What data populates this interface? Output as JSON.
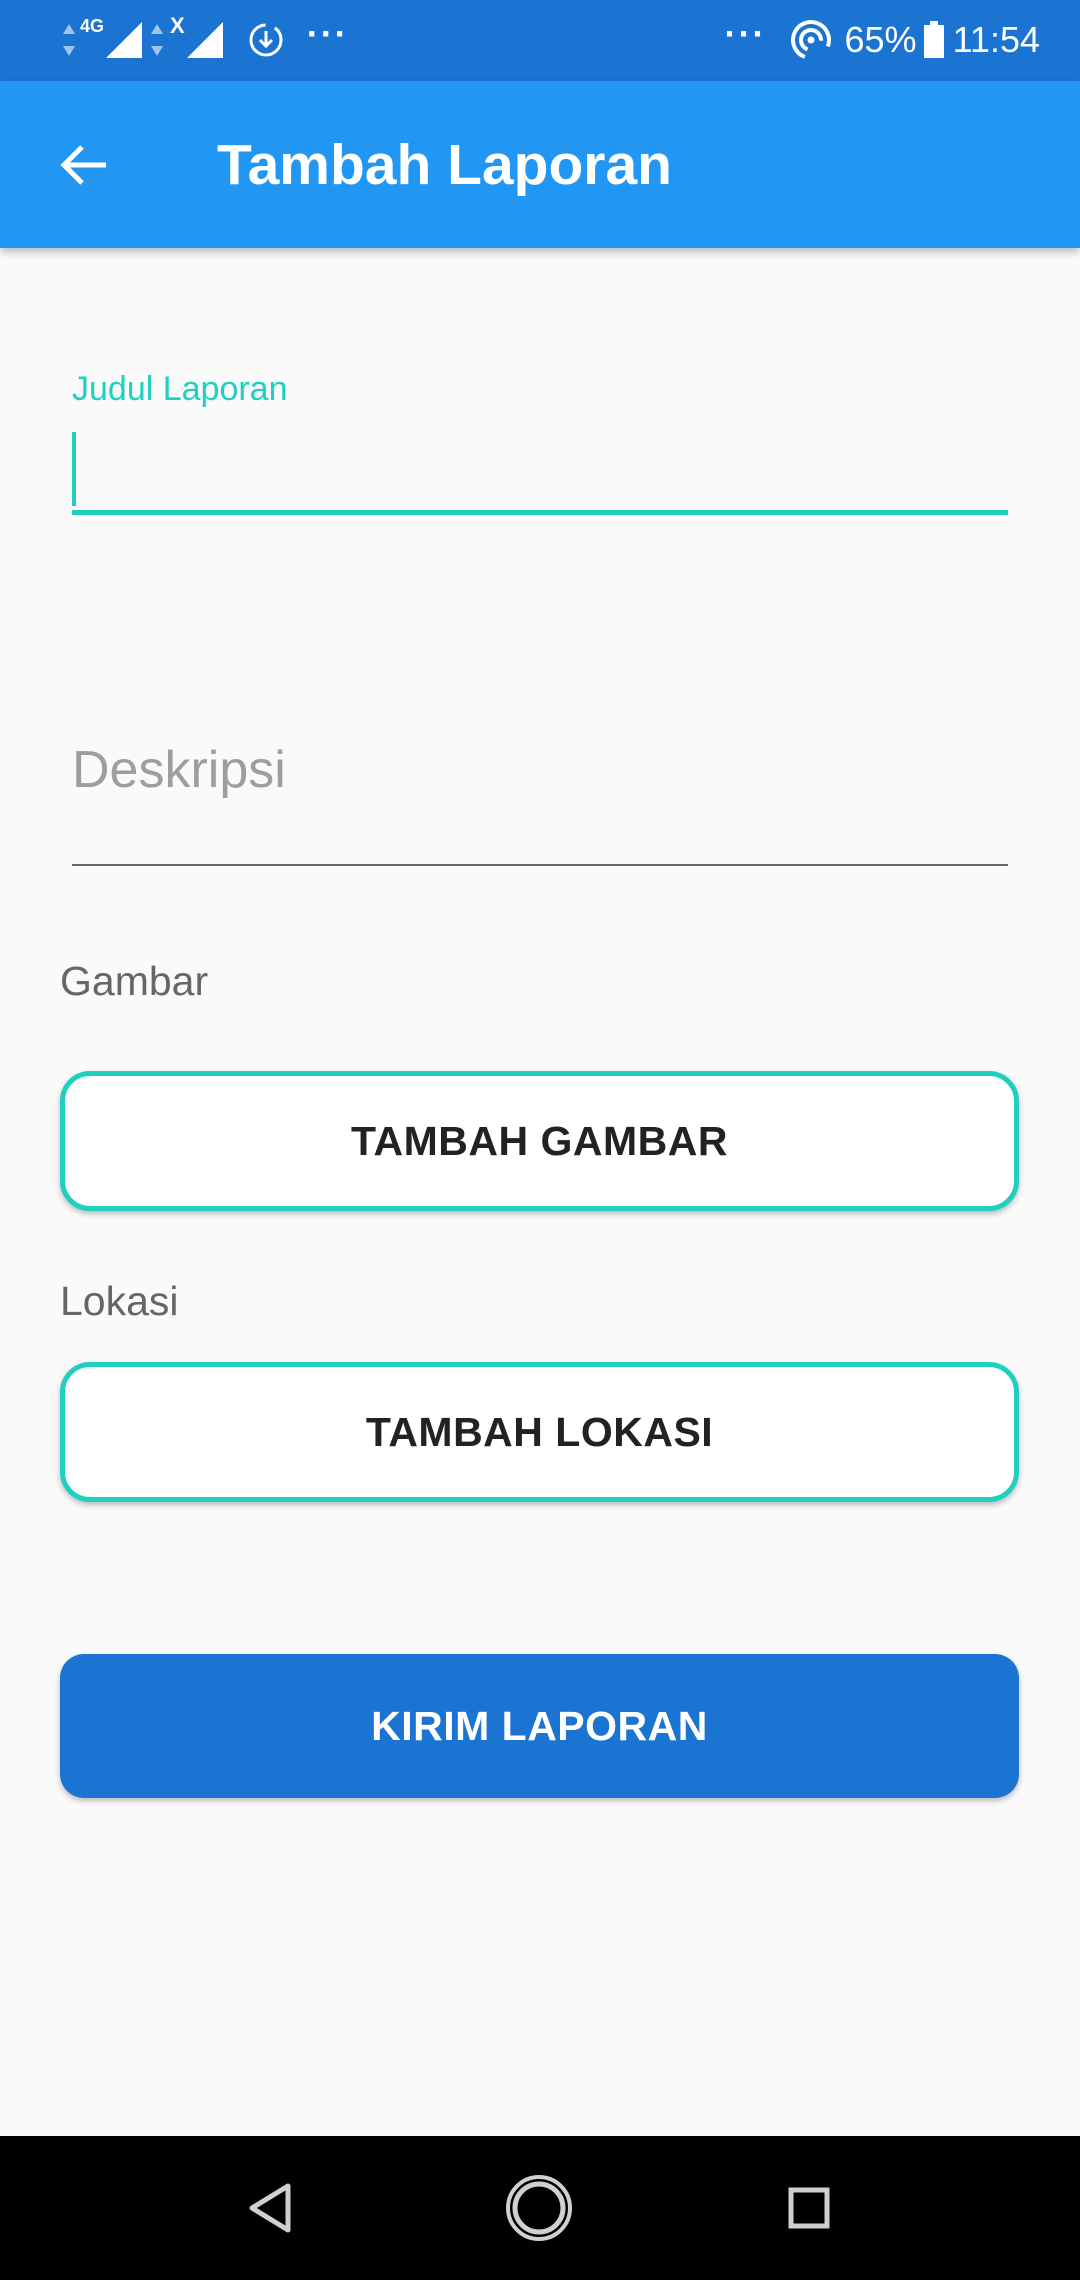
{
  "status_bar": {
    "network_label": "4G",
    "sim2_label": "X",
    "battery_percent": "65%",
    "time": "11:54",
    "more_dots": "···",
    "icons": [
      "signal-icon",
      "download-icon",
      "hotspot-icon",
      "battery-icon"
    ]
  },
  "app_bar": {
    "title": "Tambah Laporan",
    "back_icon": "arrow-left-icon",
    "background": "#2196f3"
  },
  "form": {
    "judul": {
      "label": "Judul Laporan",
      "value": ""
    },
    "deskripsi": {
      "placeholder": "Deskripsi",
      "value": ""
    },
    "gambar": {
      "section_label": "Gambar",
      "button_label": "TAMBAH GAMBAR"
    },
    "lokasi": {
      "section_label": "Lokasi",
      "button_label": "TAMBAH LOKASI"
    },
    "submit_label": "KIRIM LAPORAN"
  },
  "colors": {
    "accent": "#1fcfbf",
    "primary": "#1b74d1",
    "status_bar": "#1b74d1"
  },
  "nav_bar": {
    "icons": [
      "back-triangle-icon",
      "home-circle-icon",
      "recents-square-icon"
    ]
  }
}
